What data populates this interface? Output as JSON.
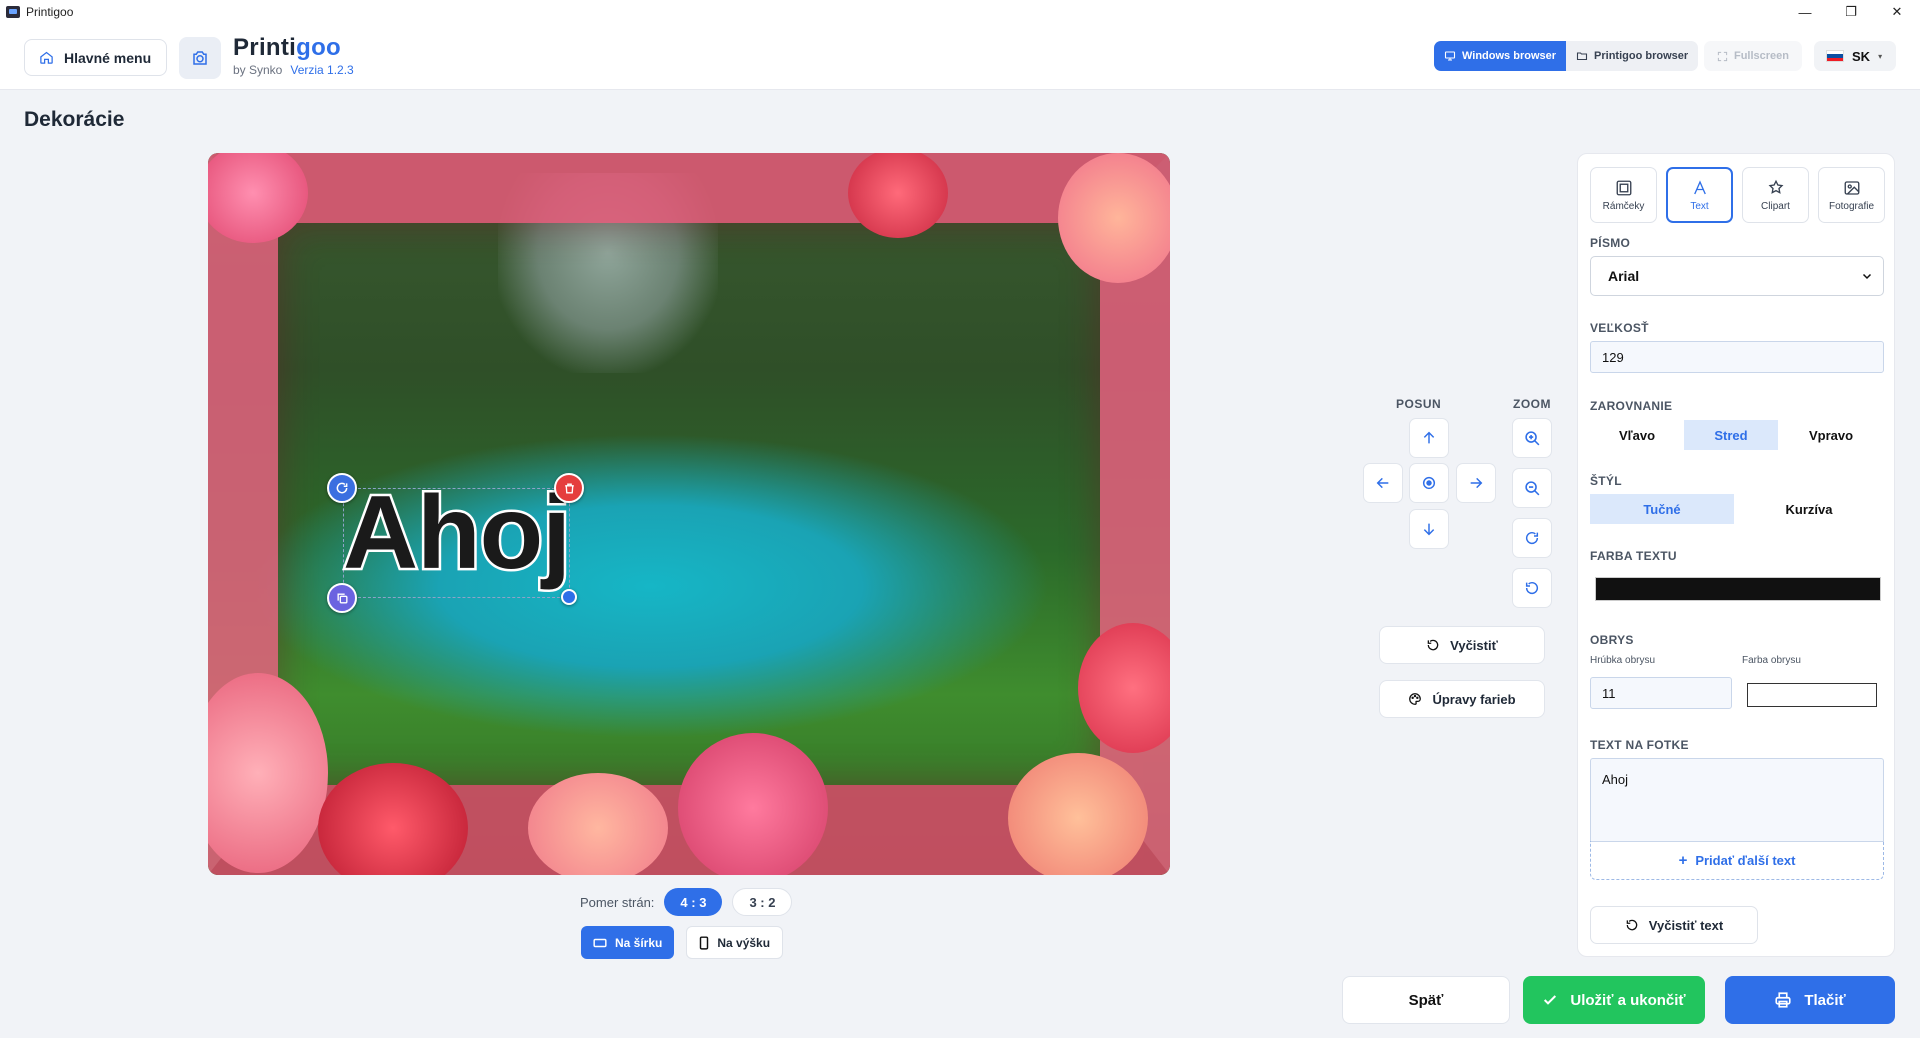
{
  "window": {
    "title": "Printigoo",
    "minimize": "—",
    "maximize": "❐",
    "close": "✕"
  },
  "header": {
    "home_label": "Hlavné menu",
    "logo_main": "Printi",
    "logo_accent": "goo",
    "by": "by Synko",
    "version": "Verzia 1.2.3",
    "browser_modes": [
      "Windows browser",
      "Printigoo browser"
    ],
    "fullscreen": "Fullscreen",
    "language": "SK"
  },
  "page_title": "Dekorácie",
  "canvas": {
    "text": "Ahoj"
  },
  "aspect": {
    "label": "Pomer strán:",
    "options": [
      "4 : 3",
      "3 : 2"
    ],
    "active": "4 : 3",
    "orientation": [
      "Na šírku",
      "Na výšku"
    ]
  },
  "controls": {
    "move_label": "POSUN",
    "zoom_label": "ZOOM",
    "clear_label": "Vyčistiť",
    "colors_label": "Úpravy farieb"
  },
  "panel": {
    "tabs": [
      "Rámčeky",
      "Text",
      "Clipart",
      "Fotografie"
    ],
    "active_tab": "Text",
    "font_label": "PÍSMO",
    "font_value": "Arial",
    "size_label": "VEĽKOSŤ",
    "size_value": "129",
    "align_label": "ZAROVNANIE",
    "align_options": [
      "Vľavo",
      "Stred",
      "Vpravo"
    ],
    "style_label": "ŠTÝL",
    "style_options": [
      "Tučné",
      "Kurzíva"
    ],
    "text_color_label": "FARBA TEXTU",
    "text_color": "#111111",
    "outline_label": "OBRYS",
    "outline_width_label": "Hrúbka obrysu",
    "outline_width": "11",
    "outline_color_label": "Farba obrysu",
    "outline_color": "#ffffff",
    "photo_text_label": "TEXT NA FOTKE",
    "photo_text": "Ahoj",
    "add_text": "Pridať ďalší text",
    "clear_text": "Vyčistiť text"
  },
  "footer": {
    "back": "Späť",
    "save": "Uložiť a ukončiť",
    "print": "Tlačiť"
  },
  "colors": {
    "accent": "#2f6fe8",
    "success": "#22c55e",
    "danger": "#e53e3e"
  }
}
